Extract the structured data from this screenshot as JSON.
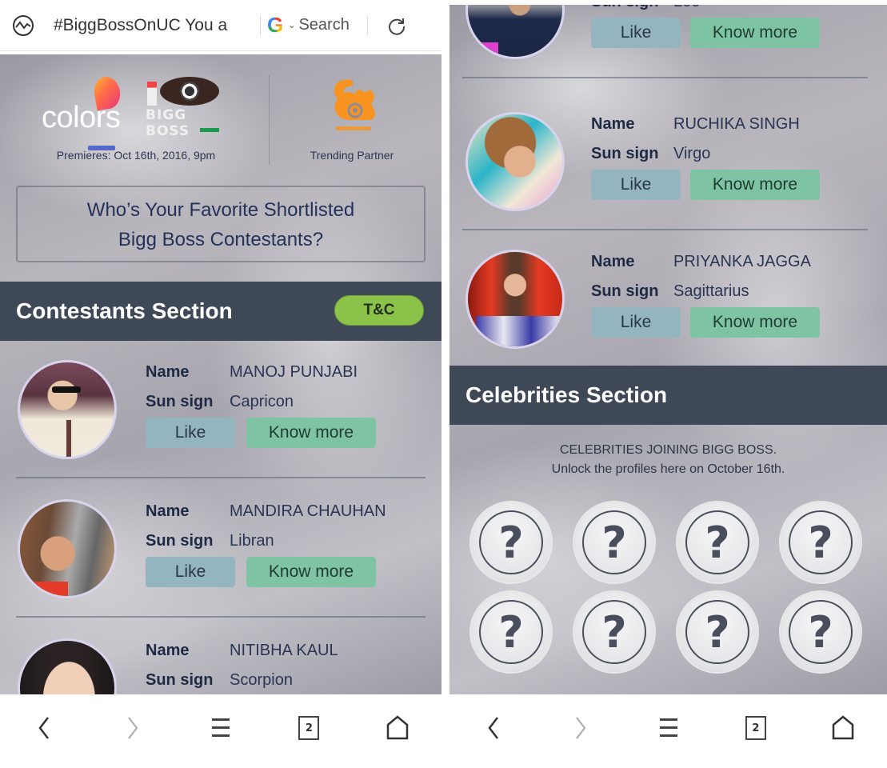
{
  "left_screen": {
    "address_bar": {
      "page_title": "#BiggBossOnUC You a",
      "search_engine": "G",
      "search_label": "Search"
    },
    "header": {
      "colors_logo_text": "colors",
      "bigg_boss_logo_text": "BIGG BOSS",
      "premieres": "Premieres: Oct 16th, 2016, 9pm",
      "partner_label": "Trending Partner"
    },
    "question": {
      "line1": "Who’s Your Favorite Shortlisted",
      "line2": "Bigg Boss Contestants?"
    },
    "contestants_section": {
      "title": "Contestants Section",
      "tc_label": "T&C"
    },
    "contestants": [
      {
        "name_label": "Name",
        "name": "MANOJ PUNJABI",
        "sign_label": "Sun sign",
        "sign": "Capricon",
        "like_label": "Like",
        "more_label": "Know more"
      },
      {
        "name_label": "Name",
        "name": "MANDIRA CHAUHAN",
        "sign_label": "Sun sign",
        "sign": "Libran",
        "like_label": "Like",
        "more_label": "Know more"
      },
      {
        "name_label": "Name",
        "name": "NITIBHA KAUL",
        "sign_label": "Sun sign",
        "sign": "Scorpion"
      }
    ]
  },
  "right_screen": {
    "contestants": [
      {
        "sign_label": "Sun sign",
        "sign": "Leo",
        "like_label": "Like",
        "more_label": "Know more"
      },
      {
        "name_label": "Name",
        "name": "RUCHIKA SINGH",
        "sign_label": "Sun sign",
        "sign": "Virgo",
        "like_label": "Like",
        "more_label": "Know more"
      },
      {
        "name_label": "Name",
        "name": "PRIYANKA JAGGA",
        "sign_label": "Sun sign",
        "sign": "Sagittarius",
        "like_label": "Like",
        "more_label": "Know more"
      }
    ],
    "celebrities_section": {
      "title": "Celebrities Section",
      "line1": "CELEBRITIES JOINING BIGG BOSS.",
      "line2": "Unlock the profiles here on October 16th.",
      "mystery_glyph": "?"
    }
  },
  "bottom_nav": {
    "tabs_count": "2",
    "icons": [
      "back-icon",
      "forward-icon",
      "menu-icon",
      "tabs-icon",
      "home-icon"
    ]
  },
  "colors": {
    "section_header": "#3f4856",
    "tc_button": "#8bc34a",
    "like_button": "#94b4bf",
    "know_more_button": "#7fc4a2",
    "uc_orange": "#f7931e"
  }
}
